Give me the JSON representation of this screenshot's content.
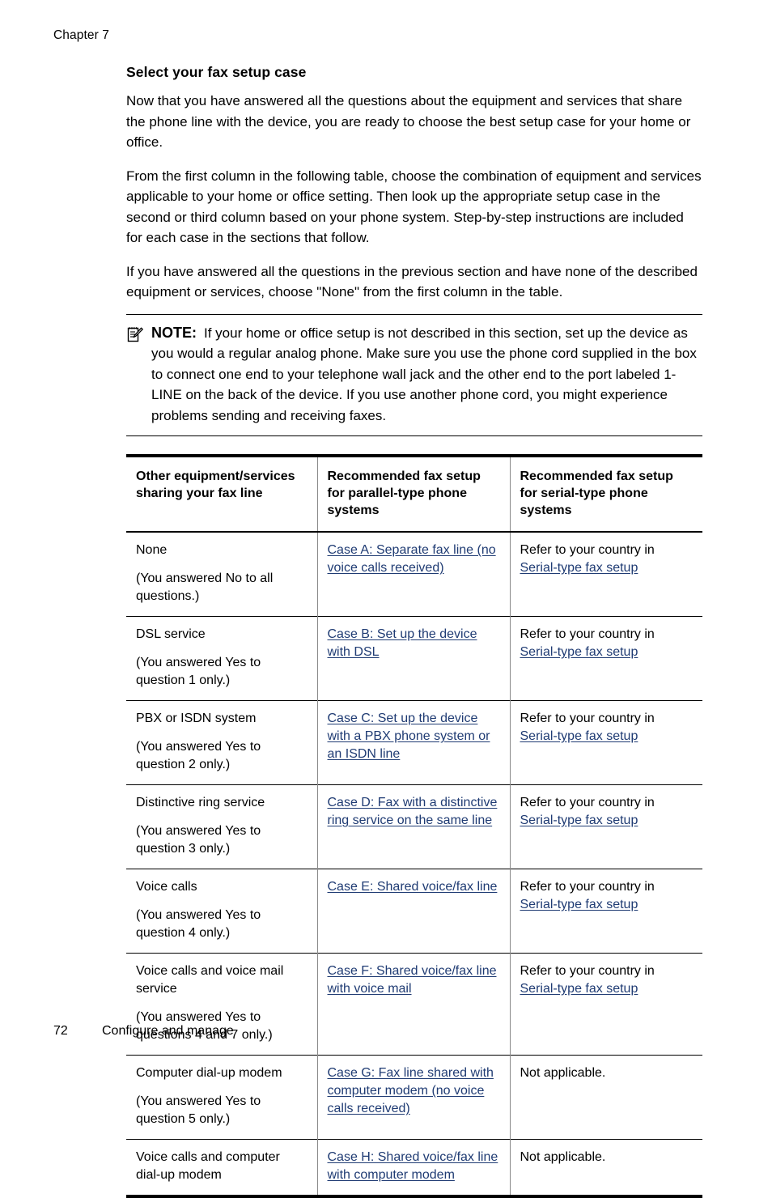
{
  "header": {
    "chapter": "Chapter 7"
  },
  "section": {
    "title": "Select your fax setup case",
    "paragraphs": [
      "Now that you have answered all the questions about the equipment and services that share the phone line with the device, you are ready to choose the best setup case for your home or office.",
      "From the first column in the following table, choose the combination of equipment and services applicable to your home or office setting. Then look up the appropriate setup case in the second or third column based on your phone system. Step-by-step instructions are included for each case in the sections that follow.",
      "If you have answered all the questions in the previous section and have none of the described equipment or services, choose \"None\" from the first column in the table."
    ]
  },
  "note": {
    "icon": "note-pencil-icon",
    "label": "NOTE:",
    "text": "If your home or office setup is not described in this section, set up the device as you would a regular analog phone. Make sure you use the phone cord supplied in the box to connect one end to your telephone wall jack and the other end to the port labeled 1-LINE on the back of the device. If you use another phone cord, you might experience problems sending and receiving faxes."
  },
  "table": {
    "columns": [
      "Other equipment/services sharing your fax line",
      "Recommended fax setup for parallel-type phone systems",
      "Recommended fax setup for serial-type phone systems"
    ],
    "rows": [
      {
        "equipment": "None",
        "answers": "(You answered No to all questions.)",
        "parallel_link": "Case A: Separate fax line (no voice calls received)",
        "serial_text": "Refer to your country in",
        "serial_link": "Serial-type fax setup"
      },
      {
        "equipment": "DSL service",
        "answers": "(You answered Yes to question 1 only.)",
        "parallel_link": "Case B: Set up the device with DSL",
        "serial_text": "Refer to your country in",
        "serial_link": "Serial-type fax setup"
      },
      {
        "equipment": "PBX or ISDN system",
        "answers": "(You answered Yes to question 2 only.)",
        "parallel_link": "Case C: Set up the device with a PBX phone system or an ISDN line",
        "serial_text": "Refer to your country in",
        "serial_link": "Serial-type fax setup"
      },
      {
        "equipment": "Distinctive ring service",
        "answers": "(You answered Yes to question 3 only.)",
        "parallel_link": "Case D: Fax with a distinctive ring service on the same line",
        "serial_text": "Refer to your country in",
        "serial_link": "Serial-type fax setup"
      },
      {
        "equipment": "Voice calls",
        "answers": "(You answered Yes to question 4 only.)",
        "parallel_link": "Case E: Shared voice/fax line",
        "serial_text": "Refer to your country in",
        "serial_link": "Serial-type fax setup"
      },
      {
        "equipment": "Voice calls and voice mail service",
        "answers": "(You answered Yes to questions 4 and 7 only.)",
        "parallel_link": "Case F: Shared voice/fax line with voice mail",
        "serial_text": "Refer to your country in",
        "serial_link": "Serial-type fax setup"
      },
      {
        "equipment": "Computer dial-up modem",
        "answers": "(You answered Yes to question 5 only.)",
        "parallel_link": "Case G: Fax line shared with computer modem (no voice calls received)",
        "serial_text": "Not applicable.",
        "serial_link": ""
      },
      {
        "equipment": "Voice calls and computer dial-up modem",
        "answers": "",
        "parallel_link": "Case H: Shared voice/fax line with computer modem",
        "serial_text": "Not applicable.",
        "serial_link": ""
      }
    ]
  },
  "footer": {
    "page_number": "72",
    "title": "Configure and manage"
  },
  "colors": {
    "link": "#1F3B73",
    "text": "#000000",
    "rule": "#8a8a8a"
  }
}
